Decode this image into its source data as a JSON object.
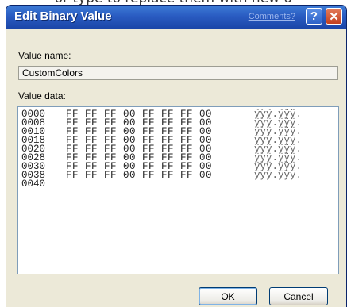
{
  "background_text": "or type to replace them with new d",
  "dialog": {
    "title": "Edit Binary Value",
    "comments_link": "Comments?",
    "help_glyph": "?",
    "close_glyph": "✕",
    "value_name_label": "Value name:",
    "value_name": "CustomColors",
    "value_data_label": "Value data:",
    "rows": [
      {
        "addr": "0000",
        "hex": "FF FF FF 00 FF FF FF 00",
        "ascii": "ÿÿÿ.ÿÿÿ."
      },
      {
        "addr": "0008",
        "hex": "FF FF FF 00 FF FF FF 00",
        "ascii": "ÿÿÿ.ÿÿÿ."
      },
      {
        "addr": "0010",
        "hex": "FF FF FF 00 FF FF FF 00",
        "ascii": "ÿÿÿ.ÿÿÿ."
      },
      {
        "addr": "0018",
        "hex": "FF FF FF 00 FF FF FF 00",
        "ascii": "ÿÿÿ.ÿÿÿ."
      },
      {
        "addr": "0020",
        "hex": "FF FF FF 00 FF FF FF 00",
        "ascii": "ÿÿÿ.ÿÿÿ."
      },
      {
        "addr": "0028",
        "hex": "FF FF FF 00 FF FF FF 00",
        "ascii": "ÿÿÿ.ÿÿÿ."
      },
      {
        "addr": "0030",
        "hex": "FF FF FF 00 FF FF FF 00",
        "ascii": "ÿÿÿ.ÿÿÿ."
      },
      {
        "addr": "0038",
        "hex": "FF FF FF 00 FF FF FF 00",
        "ascii": "ÿÿÿ.ÿÿÿ."
      },
      {
        "addr": "0040",
        "hex": "",
        "ascii": ""
      }
    ],
    "ok_label": "OK",
    "cancel_label": "Cancel"
  },
  "colors": {
    "titlebar": "#2a5cc2",
    "dialog_face": "#ece9d8",
    "button_border": "#003c74"
  }
}
